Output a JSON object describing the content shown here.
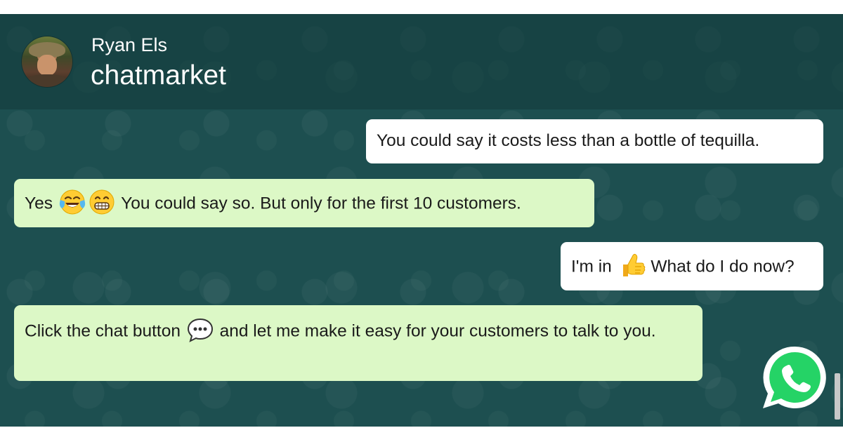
{
  "header": {
    "contact_name": "Ryan Els",
    "subtitle": "chatmarket"
  },
  "messages": [
    {
      "direction": "outgoing",
      "text_before": "You could say it costs less than a bottle of tequilla.",
      "text_after": ""
    },
    {
      "direction": "incoming",
      "text_before": "Yes ",
      "emojis": [
        "tears-of-joy-emoji",
        "grinning-face-emoji"
      ],
      "text_after": " You could say so. But only for the first 10 customers."
    },
    {
      "direction": "outgoing",
      "text_before": "I'm in ",
      "emojis": [
        "thumbs-up-emoji"
      ],
      "text_after": " What do I do now?"
    },
    {
      "direction": "incoming",
      "text_before": "Click the chat button ",
      "emojis": [
        "speech-bubble-emoji"
      ],
      "text_after": " and let me make it easy for your customers to talk to you."
    }
  ],
  "colors": {
    "chat_background": "#1d4f50",
    "incoming_bubble": "#dcf8c6",
    "outgoing_bubble": "#ffffff",
    "whatsapp_green": "#25d366"
  },
  "icons": {
    "fab": "whatsapp-icon"
  }
}
